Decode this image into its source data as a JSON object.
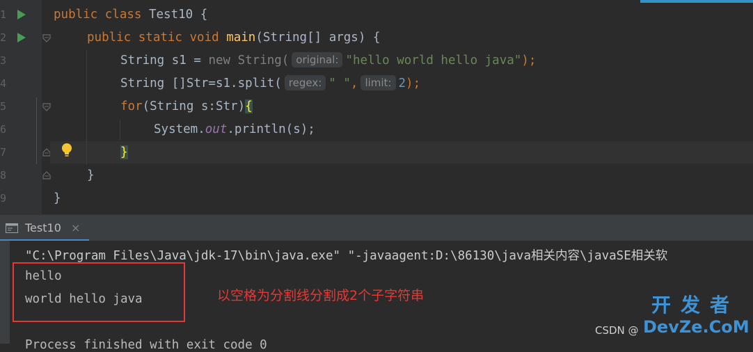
{
  "editor": {
    "line_numbers": [
      "1",
      "2",
      "3",
      "4",
      "5",
      "6",
      "7",
      "8",
      "9"
    ],
    "lines": {
      "l1_kw": "public class ",
      "l1_name": "Test10 {",
      "l2_kw": "public static void ",
      "l2_fn": "main",
      "l2_rest": "(String[] args) {",
      "l3_a": "String s1 = ",
      "l3_new": "new",
      "l3_b": " String(",
      "l3_hint": "original:",
      "l3_str": "\"hello world hello java\"",
      "l3_end": ");",
      "l4_a": "String []Str=s1.split(",
      "l4_hint1": "regex:",
      "l4_str": "\" \"",
      "l4_comma": ",",
      "l4_hint2": "limit:",
      "l4_num": "2",
      "l4_end": ");",
      "l5_kw": "for",
      "l5_a": "(String s:Str)",
      "l5_brace": "{",
      "l6_a": "System.",
      "l6_out": "out",
      "l6_b": ".println(s);",
      "l7": "}",
      "l8": "}",
      "l9": "}"
    }
  },
  "run_panel": {
    "tab_label": "Test10",
    "tab_close": "×"
  },
  "console": {
    "command": "\"C:\\Program Files\\Java\\jdk-17\\bin\\java.exe\" \"-javaagent:D:\\86130\\java相关内容\\javaSE相关软",
    "out1": "hello",
    "out2": "world hello java",
    "finish": "Process finished with exit code 0"
  },
  "annotation": "以空格为分割线分割成2个子字符串",
  "watermark": {
    "top": "开发者",
    "bottom": "DevZe.CoM",
    "csdn": "CSDN @"
  },
  "colors": {
    "keyword": "#cc7832",
    "function": "#ffc66d",
    "string": "#6a8759",
    "number": "#6897bb",
    "annotation": "#e53935"
  }
}
